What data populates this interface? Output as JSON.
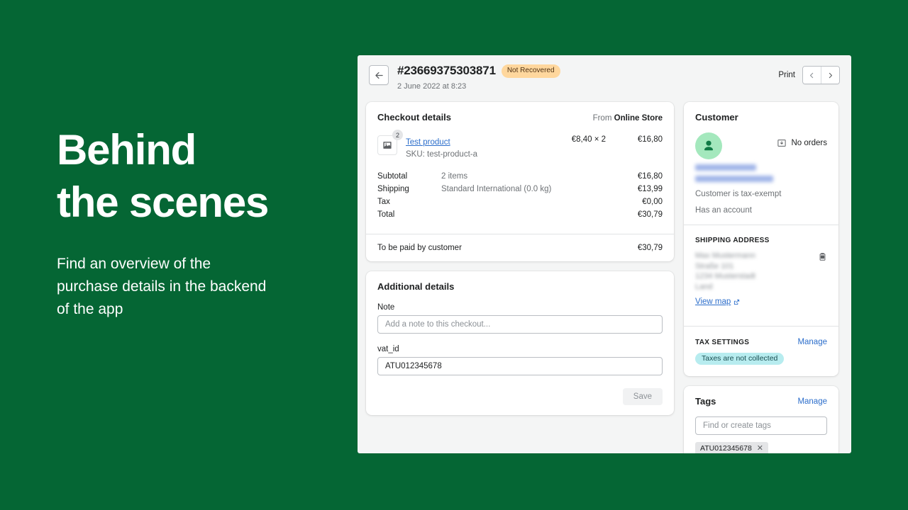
{
  "promo": {
    "headline_line1": "Behind",
    "headline_line2": "the scenes",
    "subtext": "Find an overview of the purchase details in the backend of the app"
  },
  "theme": {
    "brand_green": "#056634",
    "app_bg": "#f4f5f5",
    "link_blue": "#2c6ecb",
    "badge_amber_bg": "#ffd79d",
    "badge_teal_bg": "#b7ecef",
    "avatar_green": "#a4e8bd"
  },
  "header": {
    "back_label": "Back",
    "order_number": "#23669375303871",
    "status_badge": "Not Recovered",
    "date": "2 June 2022 at 8:23",
    "print_label": "Print",
    "prev_label": "Previous",
    "next_label": "Next"
  },
  "checkout_details": {
    "title": "Checkout details",
    "source_prefix": "From",
    "source_name": "Online Store",
    "line_item": {
      "quantity_badge": "2",
      "name": "Test product",
      "sku": "SKU: test-product-a",
      "unit_price": "€8,40 × 2",
      "line_total": "€16,80"
    },
    "totals": [
      {
        "label": "Subtotal",
        "desc": "2 items",
        "value": "€16,80"
      },
      {
        "label": "Shipping",
        "desc": "Standard International (0.0 kg)",
        "value": "€13,99"
      },
      {
        "label": "Tax",
        "desc": "",
        "value": "€0,00"
      },
      {
        "label": "Total",
        "desc": "",
        "value": "€30,79"
      }
    ],
    "paid_label": "To be paid by customer",
    "paid_value": "€30,79"
  },
  "additional_details": {
    "title": "Additional details",
    "note_label": "Note",
    "note_value": "",
    "note_placeholder": "Add a note to this checkout...",
    "vat_label": "vat_id",
    "vat_value": "ATU012345678",
    "vat_placeholder": "",
    "save_label": "Save"
  },
  "customer": {
    "title": "Customer",
    "orders_text": "No orders",
    "name_redacted": "Max Mustermann",
    "email_redacted": "Max@mustermann.com",
    "tax_exempt_text": "Customer is tax-exempt",
    "account_text": "Has an account",
    "shipping_title": "SHIPPING ADDRESS",
    "address_lines": [
      "Max Mustermann",
      "Straße 101",
      "1234 Musterstadt",
      "Land"
    ],
    "view_map_label": "View map",
    "tax_settings_title": "TAX SETTINGS",
    "tax_manage_label": "Manage",
    "tax_status_badge": "Taxes are not collected"
  },
  "tags": {
    "title": "Tags",
    "manage_label": "Manage",
    "input_value": "",
    "input_placeholder": "Find or create tags",
    "chips": [
      "ATU012345678"
    ]
  }
}
